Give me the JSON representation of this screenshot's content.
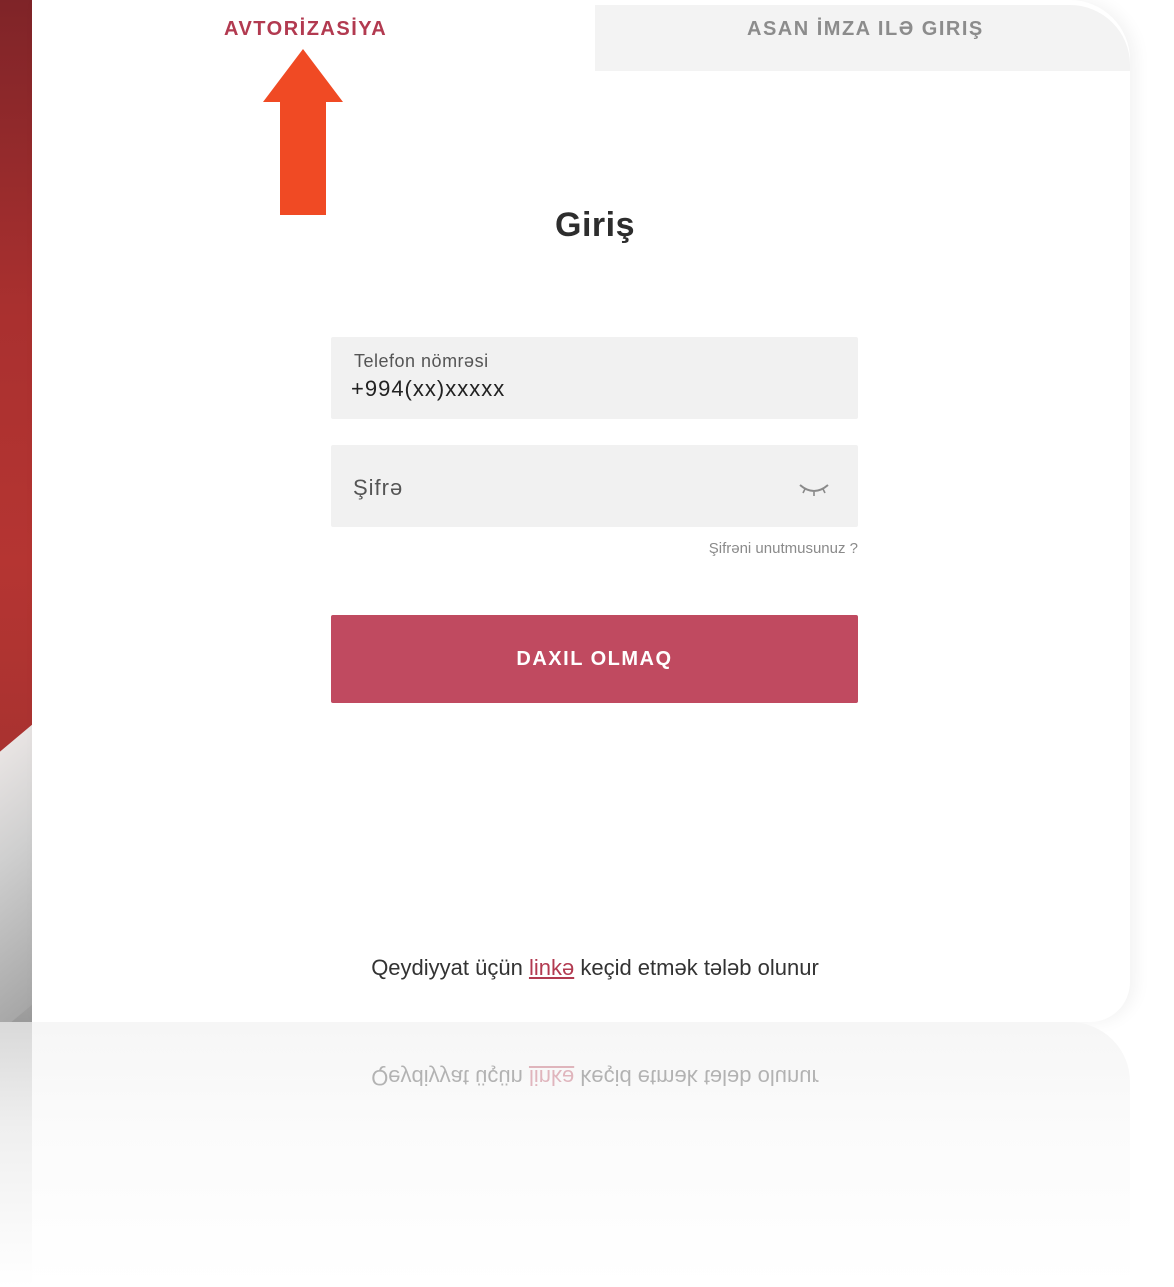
{
  "tabs": {
    "authorization": "AVTORİZASİYA",
    "asan_imza": "ASAN İMZA ILƏ GIRIŞ"
  },
  "form": {
    "title": "Giriş",
    "phone_label": "Telefon nömrəsi",
    "phone_value": "+994(xx)xxxxx",
    "password_placeholder": "Şifrə",
    "forgot_password": "Şifrəni unutmusunuz ?",
    "login_button": "DAXIL OLMAQ"
  },
  "footer": {
    "register_prefix": "Qeydiyyat üçün",
    "register_link": "linkə",
    "register_suffix": "keçid etmək tələb olunur"
  },
  "icons": {
    "password_toggle": "eye-closed-icon",
    "annotation": "arrow-up-icon"
  },
  "colors": {
    "accent": "#c04a60",
    "active_tab_text": "#b23a50",
    "inactive_tab_text": "#8c8c8c",
    "field_background": "#f1f1f1",
    "annotation_arrow": "#f04a24",
    "side_panel": "#a9302f"
  }
}
